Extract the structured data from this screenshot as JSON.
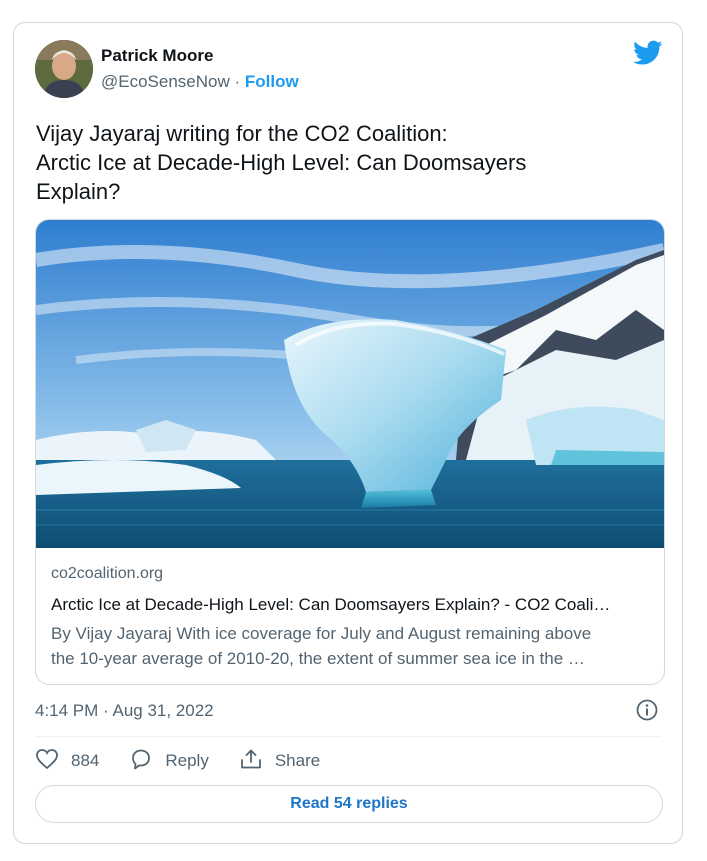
{
  "author": {
    "name": "Patrick Moore",
    "handle": "@EcoSenseNow",
    "separator": " · ",
    "follow_label": "Follow"
  },
  "tweet": {
    "lines": [
      "Vijay Jayaraj writing for the CO2 Coalition:",
      "Arctic Ice at Decade-High Level: Can Doomsayers",
      "Explain?"
    ]
  },
  "link_card": {
    "domain": "co2coalition.org",
    "title": "Arctic Ice at Decade-High Level: Can Doomsayers Explain? - CO2 Coali…",
    "description_lines": [
      "By Vijay Jayaraj With ice coverage for July and August remaining above",
      "the 10-year average of 2010-20, the extent of summer sea ice in the …"
    ]
  },
  "timestamp": "4:14 PM · Aug 31, 2022",
  "actions": {
    "like_count": "884",
    "reply_label": "Reply",
    "share_label": "Share"
  },
  "read_replies_label": "Read 54 replies",
  "colors": {
    "accent": "#1d9bf0",
    "text": "#0f1419",
    "secondary": "#536471",
    "border": "#cfd9de"
  },
  "icons": [
    "twitter-bird-icon",
    "info-icon",
    "heart-icon",
    "reply-icon",
    "share-icon"
  ]
}
